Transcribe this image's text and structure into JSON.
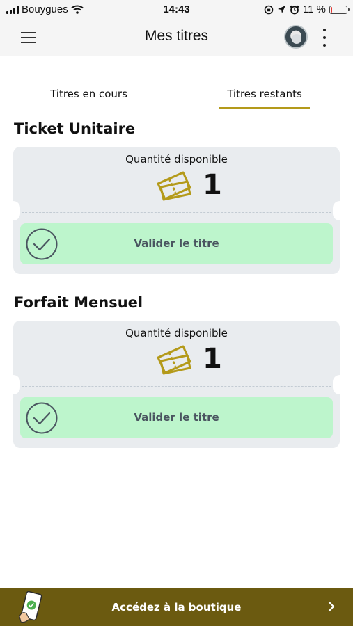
{
  "status_bar": {
    "carrier": "Bouygues",
    "time": "14:43",
    "battery_percent": "11 %",
    "battery_level": 0.11
  },
  "header": {
    "title": "Mes titres",
    "menu_icon": "hamburger-icon",
    "more_icon": "kebab-icon"
  },
  "tabs": [
    {
      "label": "Titres en cours",
      "active": false
    },
    {
      "label": "Titres restants",
      "active": true
    }
  ],
  "tickets": [
    {
      "title": "Ticket Unitaire",
      "quantity_label": "Quantité disponible",
      "quantity": "1",
      "validate_label": "Valider le titre"
    },
    {
      "title": "Forfait Mensuel",
      "quantity_label": "Quantité disponible",
      "quantity": "1",
      "validate_label": "Valider le titre"
    }
  ],
  "bottom_bar": {
    "label": "Accédez à la boutique"
  },
  "colors": {
    "accent": "#b49a1a",
    "card_bg": "#e9ecef",
    "validate_bg": "#bdf5cc",
    "bottom_bar_bg": "#6b5a10",
    "battery_low": "#e53935"
  }
}
